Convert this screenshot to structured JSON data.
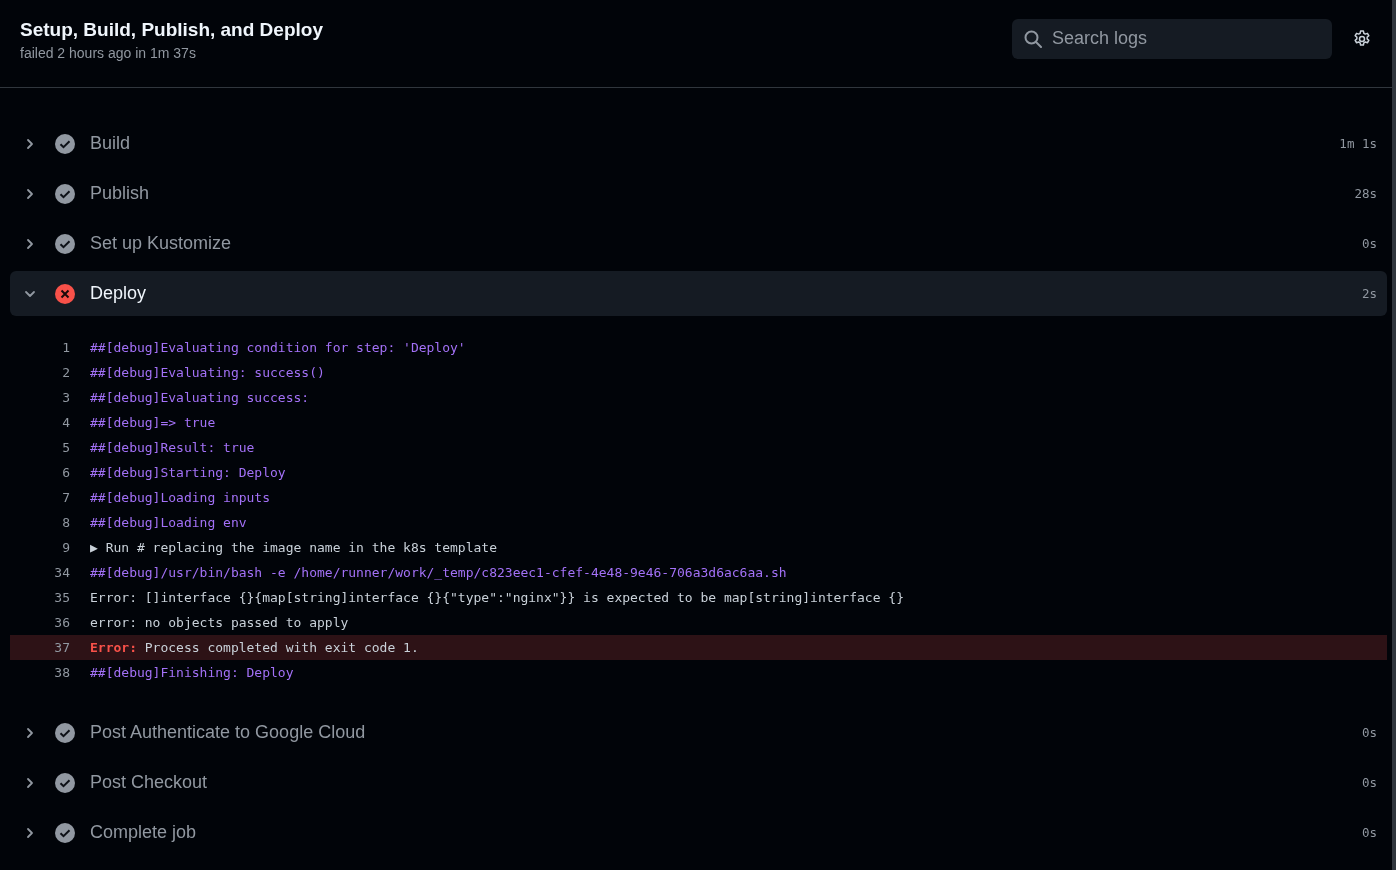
{
  "header": {
    "title": "Setup, Build, Publish, and Deploy",
    "subtitle": "failed 2 hours ago in 1m 37s",
    "search": {
      "placeholder": "Search logs"
    }
  },
  "steps": [
    {
      "name": "Build",
      "duration": "1m 1s",
      "failed": false,
      "expanded": false
    },
    {
      "name": "Publish",
      "duration": "28s",
      "failed": false,
      "expanded": false
    },
    {
      "name": "Set up Kustomize",
      "duration": "0s",
      "failed": false,
      "expanded": false
    },
    {
      "name": "Deploy",
      "duration": "2s",
      "failed": true,
      "expanded": true,
      "log": [
        {
          "n": "1",
          "kind": "debug",
          "text": "##[debug]Evaluating condition for step: 'Deploy'"
        },
        {
          "n": "2",
          "kind": "debug",
          "text": "##[debug]Evaluating: success()"
        },
        {
          "n": "3",
          "kind": "debug",
          "text": "##[debug]Evaluating success:"
        },
        {
          "n": "4",
          "kind": "debug",
          "text": "##[debug]=> true"
        },
        {
          "n": "5",
          "kind": "debug",
          "text": "##[debug]Result: true"
        },
        {
          "n": "6",
          "kind": "debug",
          "text": "##[debug]Starting: Deploy"
        },
        {
          "n": "7",
          "kind": "debug",
          "text": "##[debug]Loading inputs"
        },
        {
          "n": "8",
          "kind": "debug",
          "text": "##[debug]Loading env"
        },
        {
          "n": "9",
          "kind": "group",
          "marker": "▶",
          "text": "Run # replacing the image name in the k8s template"
        },
        {
          "n": "34",
          "kind": "debug",
          "text": "##[debug]/usr/bin/bash -e /home/runner/work/_temp/c823eec1-cfef-4e48-9e46-706a3d6ac6aa.sh"
        },
        {
          "n": "35",
          "kind": "plain",
          "text": "Error: []interface {}{map[string]interface {}{\"type\":\"nginx\"}} is expected to be map[string]interface {}"
        },
        {
          "n": "36",
          "kind": "plain",
          "text": "error: no objects passed to apply"
        },
        {
          "n": "37",
          "kind": "error",
          "prefix": "Error:",
          "text": "Process completed with exit code 1."
        },
        {
          "n": "38",
          "kind": "debug",
          "text": "##[debug]Finishing: Deploy"
        }
      ]
    },
    {
      "name": "Post Authenticate to Google Cloud",
      "duration": "0s",
      "failed": false,
      "expanded": false
    },
    {
      "name": "Post Checkout",
      "duration": "0s",
      "failed": false,
      "expanded": false
    },
    {
      "name": "Complete job",
      "duration": "0s",
      "failed": false,
      "expanded": false
    }
  ]
}
